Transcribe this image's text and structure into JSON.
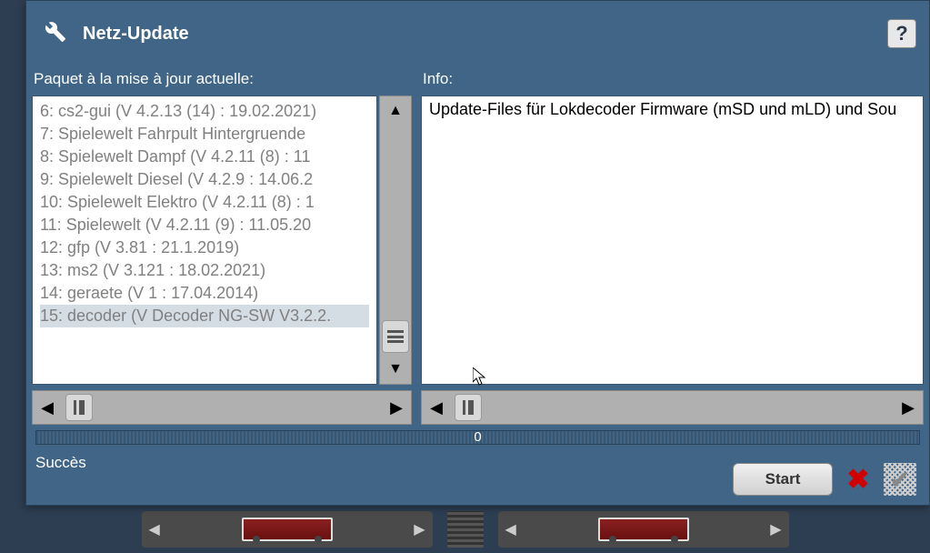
{
  "header": {
    "title": "Netz-Update",
    "help": "?"
  },
  "packageLabel": "Paquet à la mise à jour actuelle:",
  "infoLabel": "Info:",
  "packages": [
    "6: cs2-gui (V 4.2.13 (14) : 19.02.2021)",
    "7: Spielewelt Fahrpult Hintergruende ",
    "8: Spielewelt Dampf (V 4.2.11 (8) : 11",
    "9: Spielewelt Diesel (V 4.2.9 : 14.06.2",
    "10: Spielewelt Elektro (V 4.2.11 (8) : 1",
    "11: Spielewelt (V 4.2.11 (9) : 11.05.20",
    "12: gfp (V 3.81 : 21.1.2019)",
    "13: ms2 (V 3.121 : 18.02.2021)",
    "14: geraete (V 1 : 17.04.2014)",
    "15: decoder (V Decoder NG-SW V3.2.2."
  ],
  "selectedIndex": 9,
  "infoText": "Update-Files für Lokdecoder Firmware (mSD und mLD) und Sou",
  "progressValue": "0",
  "statusText": "Succès",
  "buttons": {
    "start": "Start"
  }
}
